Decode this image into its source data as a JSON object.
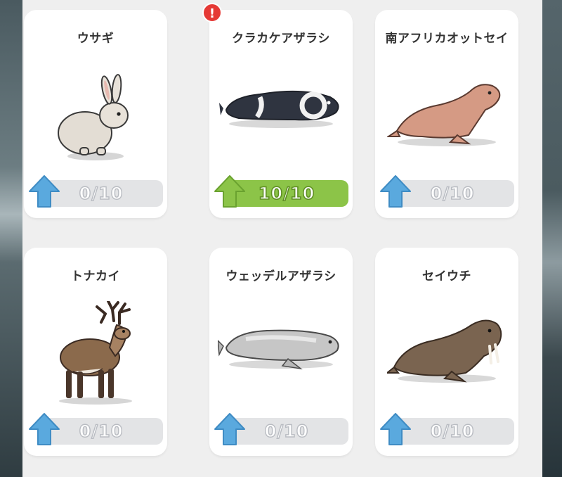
{
  "cards": [
    {
      "name": "ウサギ",
      "progress": "0/10",
      "complete": false,
      "alert": false,
      "icon": "rabbit-icon"
    },
    {
      "name": "クラカケアザラシ",
      "progress": "10/10",
      "complete": true,
      "alert": true,
      "alert_symbol": "!",
      "icon": "ribbon-seal-icon"
    },
    {
      "name": "南アフリカオットセイ",
      "progress": "0/10",
      "complete": false,
      "alert": false,
      "icon": "fur-seal-icon"
    },
    {
      "name": "トナカイ",
      "progress": "0/10",
      "complete": false,
      "alert": false,
      "icon": "reindeer-icon"
    },
    {
      "name": "ウェッデルアザラシ",
      "progress": "0/10",
      "complete": false,
      "alert": false,
      "icon": "weddell-seal-icon"
    },
    {
      "name": "セイウチ",
      "progress": "0/10",
      "complete": false,
      "alert": false,
      "icon": "walrus-icon"
    }
  ],
  "colors": {
    "upgrade_blue": "#5aa9de",
    "complete_green": "#8cc448",
    "alert_red": "#e53935"
  }
}
